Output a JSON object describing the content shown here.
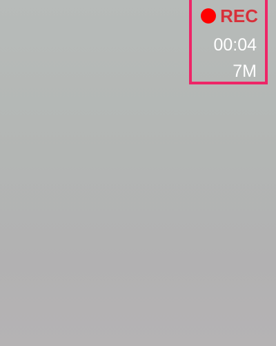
{
  "recording": {
    "indicator_icon": "record-dot-icon",
    "label": "REC",
    "elapsed": "00:04",
    "file_size": "7M"
  },
  "colors": {
    "rec_dot": "#ff0000",
    "rec_label": "#d8303a",
    "overlay_border": "#ee2567",
    "info_text": "#ffffff"
  }
}
